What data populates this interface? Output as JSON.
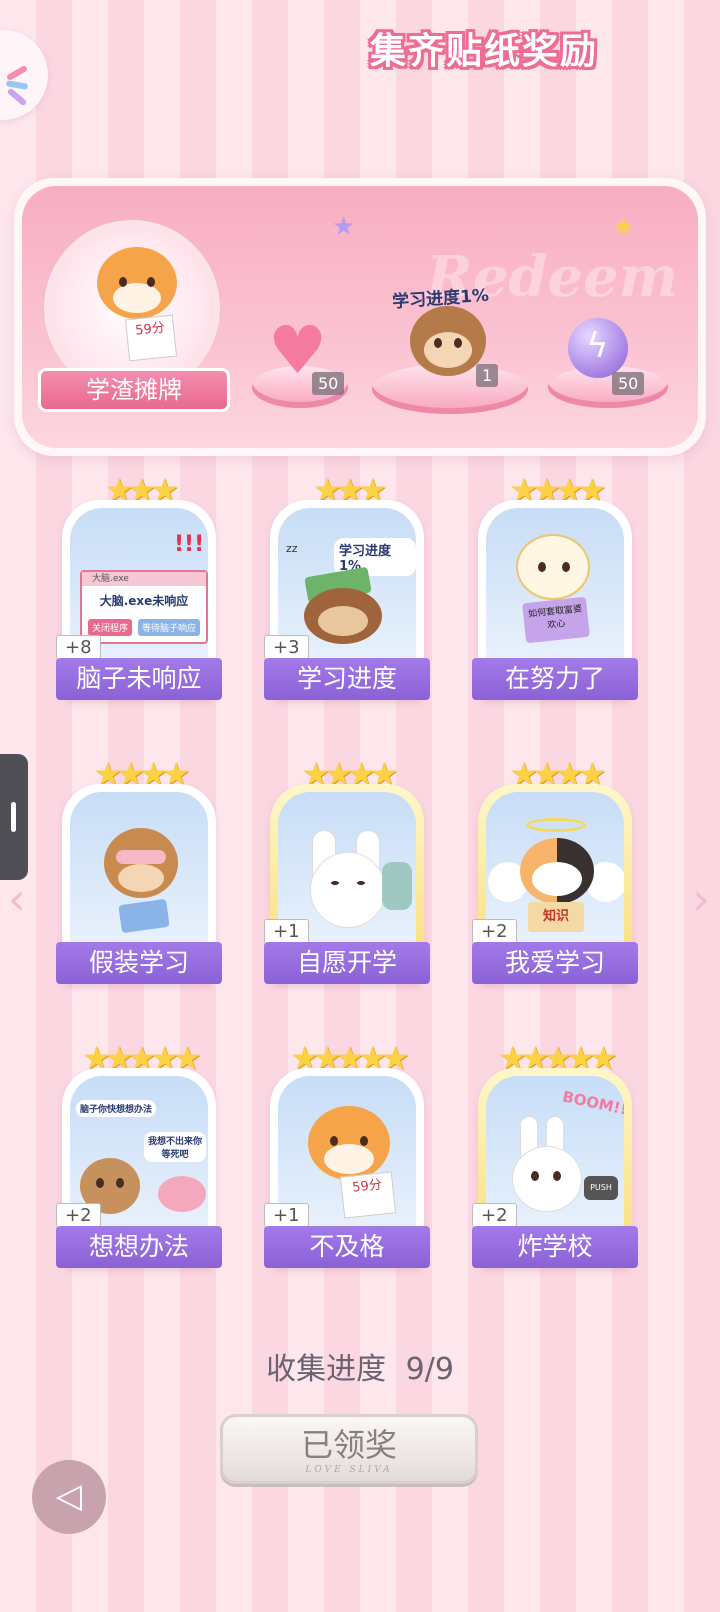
{
  "header": {
    "title": "集齐贴纸奖励",
    "watermark": "Redeem",
    "featured_label": "学渣摊牌",
    "featured_score": "59分",
    "progress_note": "学习进度1%",
    "rewards": [
      {
        "icon": "heart-gem-icon",
        "count": "50"
      },
      {
        "icon": "monkey-sticker-icon",
        "count": "1"
      },
      {
        "icon": "energy-orb-icon",
        "count": "50"
      }
    ]
  },
  "stickers": [
    {
      "label": "脑子未响应",
      "badge": "+8",
      "stars": "★★★",
      "art_text": "大脑.exe未响应",
      "art_btn1": "关闭程序",
      "art_btn2": "等待脑子响应",
      "art_title": "大脑.exe"
    },
    {
      "label": "学习进度",
      "badge": "+3",
      "stars": "★★★",
      "art_text": "学习进度1%"
    },
    {
      "label": "在努力了",
      "badge": "",
      "stars": "★★★★",
      "art_text": "如何套取富婆欢心"
    },
    {
      "label": "假装学习",
      "badge": "",
      "stars": "★★★★"
    },
    {
      "label": "自愿开学",
      "badge": "+1",
      "stars": "★★★★"
    },
    {
      "label": "我爱学习",
      "badge": "+2",
      "stars": "★★★★",
      "art_text": "知识"
    },
    {
      "label": "想想办法",
      "badge": "+2",
      "stars": "★★★★★",
      "art_text": "脑子你快想想办法",
      "art_text2": "我想不出来你等死吧"
    },
    {
      "label": "不及格",
      "badge": "+1",
      "stars": "★★★★★",
      "art_text": "59分"
    },
    {
      "label": "炸学校",
      "badge": "+2",
      "stars": "★★★★★",
      "art_text": "BOOM!!",
      "art_text2": "PUSH"
    }
  ],
  "footer": {
    "progress_label": "收集进度",
    "progress_value": "9/9",
    "claimed_button": "已领奖",
    "claimed_sub": "LOVE SLIVA"
  }
}
